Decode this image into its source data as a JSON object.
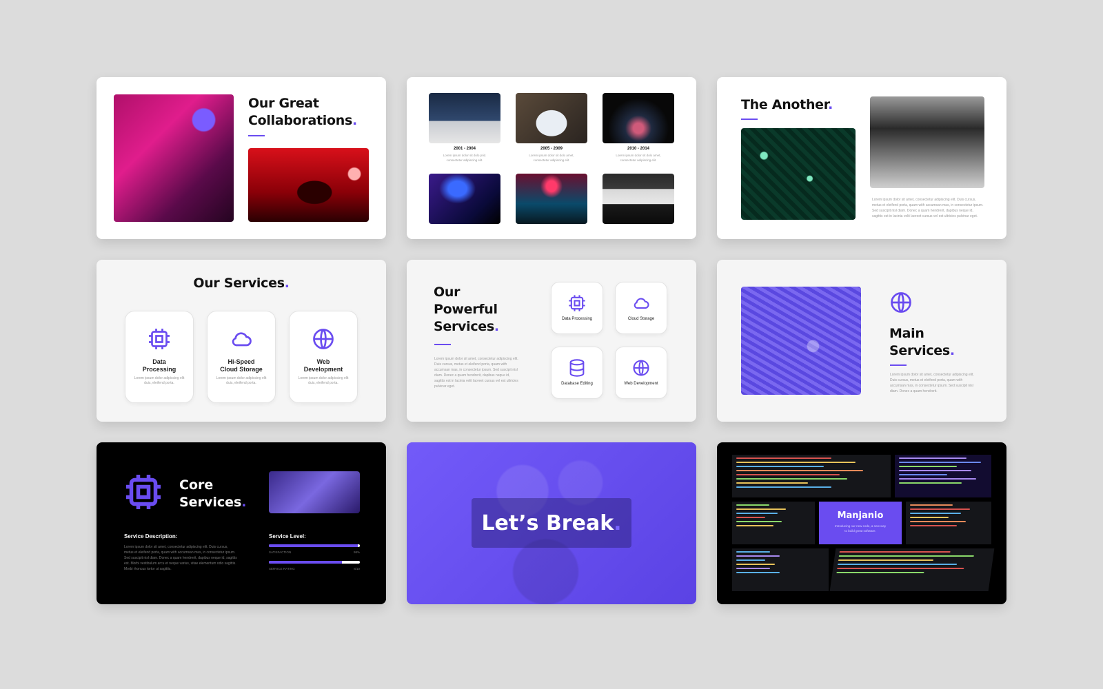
{
  "colors": {
    "accent": "#6a4cf0",
    "background": "#dcdcdc"
  },
  "slide1": {
    "title_line1": "Our Great",
    "title_line2": "Collaborations",
    "dot": "."
  },
  "slide2": {
    "items": [
      {
        "years": "2001 - 2004",
        "desc1": "Lorem ipsum dolor sit dolo prid.",
        "desc2": "consectetur adipiscing elit."
      },
      {
        "years": "2005 - 2009",
        "desc1": "Lorem ipsum dolor sit dolo amet,",
        "desc2": "consectetur adipiscing elit."
      },
      {
        "years": "2010 - 2014",
        "desc1": "Lorem ipsum dolor sit dolo amet,",
        "desc2": "consectetur adipiscing elit."
      }
    ]
  },
  "slide3": {
    "title": "The Another",
    "dot": ".",
    "para": "Lorem ipsum dolor sit amet, consectetur adipiscing elit. Duis cursus, metus et eleifend porta, quam with accumsan mas, in consectetur ipsum. Sed suscipit nisl diam. Donec a quam hendrerit, dapibus neque id, sagittis est in lacinia velit laoreet cursus vel est ultricies pulvinar eget."
  },
  "slide4": {
    "title": "Our Services",
    "dot": ".",
    "cards": [
      {
        "l1": "Data",
        "l2": "Processing",
        "desc": "Lorem ipsum dolor adipiscing elit duis, eleifend porta."
      },
      {
        "l1": "Hi-Speed",
        "l2": "Cloud Storage",
        "desc": "Lorem ipsum dolor adipiscing elit duis, eleifend porta."
      },
      {
        "l1": "Web",
        "l2": "Development",
        "desc": "Lorem ipsum dolor adipiscing elit duis, eleifend porta."
      }
    ]
  },
  "slide5": {
    "l1": "Our",
    "l2": "Powerful",
    "l3": "Services",
    "dot": ".",
    "para": "Lorem ipsum dolor sit amet, consectetur adipiscing elit. Duis cursus, metus et eleifend porta, quam with accumsan mas, in consectetur ipsum. Sed suscipit nisl diam. Donec a quam hendrerit, dapibus neque id, sagittis est in lacinia velit laoreet cursus vel est ultricies pulvinar eget.",
    "items": [
      "Data Processing",
      "Cloud Storage",
      "Database Editing",
      "Web Development"
    ]
  },
  "slide6": {
    "l1": "Main",
    "l2": "Services",
    "dot": ".",
    "para": "Lorem ipsum dolor sit amet, consectetur adipiscing elit. Duis cursus, metus et eleifend porta, quam with accumsan mas, in consectetur ipsum. Sed suscipit nisl diam. Donec a quam hendrerit."
  },
  "slide7": {
    "l1": "Core",
    "l2": "Services",
    "dot": ".",
    "desc_label": "Service Description:",
    "para": "Lorem ipsum dolor sit amet, consectetur adipiscing elit. Duis cursus, metus et eleifend porta, quam with accumsan mas, in consectetur ipsum. Sed suscipit nisl diam. Donec a quam hendrerit, dapibus neque id, sagittis est. Morbi vestibulum arcu et neque varius, vitae elementum odio sagittis. Morbi rhoncus tortor ut sagittis.",
    "level_label": "Service Level:",
    "bars": [
      {
        "name": "SATISFACTION",
        "value": "98%",
        "fraction": 0.98
      },
      {
        "name": "SERVICE RATING",
        "value": "8/10",
        "fraction": 0.8
      }
    ]
  },
  "slide8": {
    "title": "Let’s Break",
    "dot": "."
  },
  "slide9": {
    "name": "Manjanio",
    "sub1": "Introducing our new code, a new way",
    "sub2": "to build great software."
  }
}
